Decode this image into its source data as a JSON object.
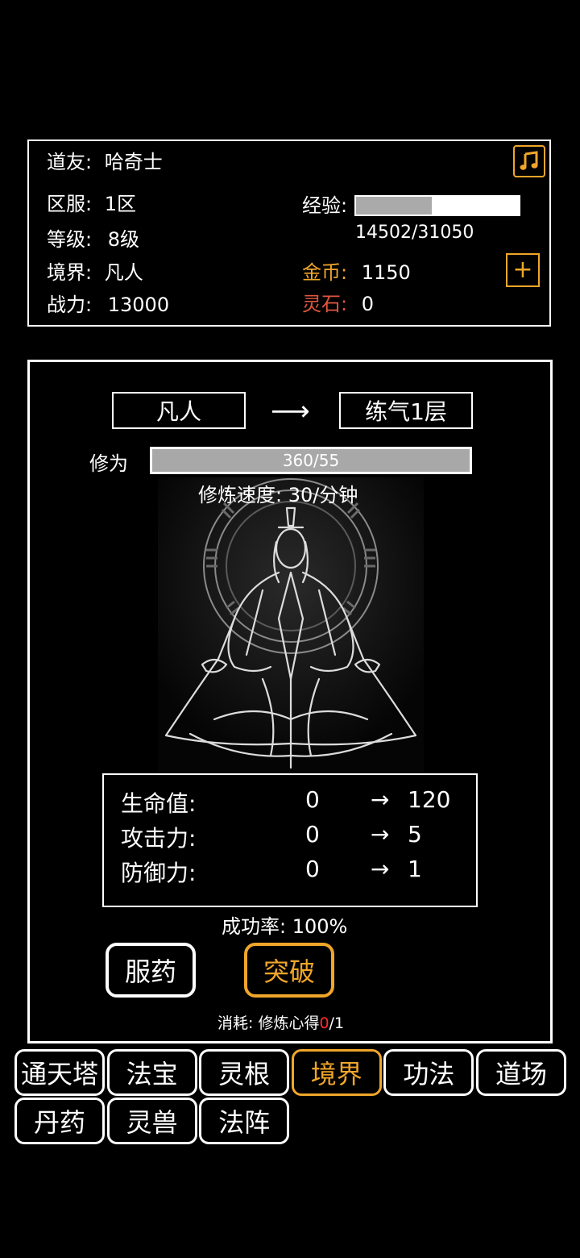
{
  "info": {
    "daoyou_label": "道友:",
    "daoyou_value": "哈奇士",
    "server_label": "区服:",
    "server_value": "1区",
    "level_label": "等级:",
    "level_value": "8级",
    "realm_label": "境界:",
    "realm_value": "凡人",
    "power_label": "战力:",
    "power_value": "13000",
    "exp_label": "经验:",
    "exp_text": "14502/31050",
    "exp_fraction": 0.467,
    "gold_label": "金币:",
    "gold_value": "1150",
    "spirit_stone_label": "灵石:",
    "spirit_stone_value": "0",
    "plus_label": "+"
  },
  "realm": {
    "current": "凡人",
    "arrow": "⟶",
    "next": "练气1层",
    "cultivation_label": "修为",
    "cultivation_text": "360/55",
    "cultivation_fraction": 1.0,
    "speed_text": "修炼速度: 30/分钟"
  },
  "stats": [
    {
      "label": "生命值:",
      "current": "0",
      "arrow": "→",
      "next": "120"
    },
    {
      "label": "攻击力:",
      "current": "0",
      "arrow": "→",
      "next": "5"
    },
    {
      "label": "防御力:",
      "current": "0",
      "arrow": "→",
      "next": "1"
    }
  ],
  "success_rate": "成功率: 100%",
  "buttons": {
    "medicine": "服药",
    "breakthrough": "突破"
  },
  "cost": {
    "prefix": "消耗: 修炼心得",
    "have": "0",
    "need": "/1"
  },
  "nav": [
    {
      "label": "通天塔",
      "active": false
    },
    {
      "label": "法宝",
      "active": false
    },
    {
      "label": "灵根",
      "active": false
    },
    {
      "label": "境界",
      "active": true
    },
    {
      "label": "功法",
      "active": false
    },
    {
      "label": "道场",
      "active": false
    },
    {
      "label": "丹药",
      "active": false
    },
    {
      "label": "灵兽",
      "active": false
    },
    {
      "label": "法阵",
      "active": false
    }
  ],
  "colors": {
    "accent": "#f0a62a",
    "spirit_stone": "#e0553f",
    "cost_red": "#ff2a2a"
  }
}
